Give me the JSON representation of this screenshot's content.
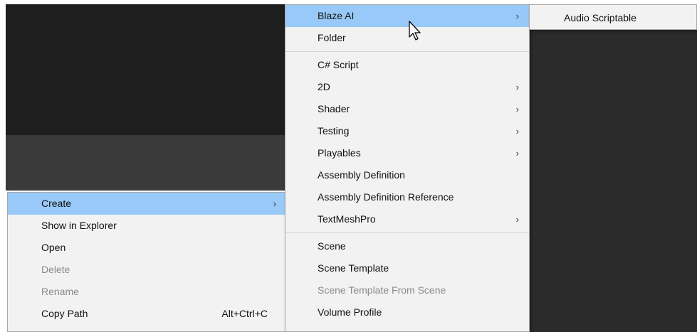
{
  "context_menu": {
    "items": [
      {
        "label": "Create",
        "has_submenu": true,
        "highlighted": true
      },
      {
        "label": "Show in Explorer"
      },
      {
        "label": "Open"
      },
      {
        "label": "Delete",
        "disabled": true
      },
      {
        "label": "Rename",
        "disabled": true
      },
      {
        "label": "Copy Path",
        "shortcut": "Alt+Ctrl+C"
      }
    ],
    "submenu_arrow": "›"
  },
  "create_menu": {
    "items": [
      {
        "label": "Blaze AI",
        "has_submenu": true,
        "highlighted": true
      },
      {
        "label": "Folder"
      },
      {
        "label": "C# Script"
      },
      {
        "label": "2D",
        "has_submenu": true
      },
      {
        "label": "Shader",
        "has_submenu": true
      },
      {
        "label": "Testing",
        "has_submenu": true
      },
      {
        "label": "Playables",
        "has_submenu": true
      },
      {
        "label": "Assembly Definition"
      },
      {
        "label": "Assembly Definition Reference"
      },
      {
        "label": "TextMeshPro",
        "has_submenu": true
      },
      {
        "label": "Scene"
      },
      {
        "label": "Scene Template"
      },
      {
        "label": "Scene Template From Scene",
        "disabled": true
      },
      {
        "label": "Volume Profile"
      }
    ]
  },
  "blaze_menu": {
    "items": [
      {
        "label": "Audio Scriptable"
      }
    ]
  },
  "colors": {
    "highlight": "#99c9f8",
    "menu_bg": "#f2f2f2",
    "disabled_text": "#8a8a8a"
  },
  "icons": {
    "submenu": "chevron-right-icon",
    "pointer": "mouse-cursor-icon"
  }
}
